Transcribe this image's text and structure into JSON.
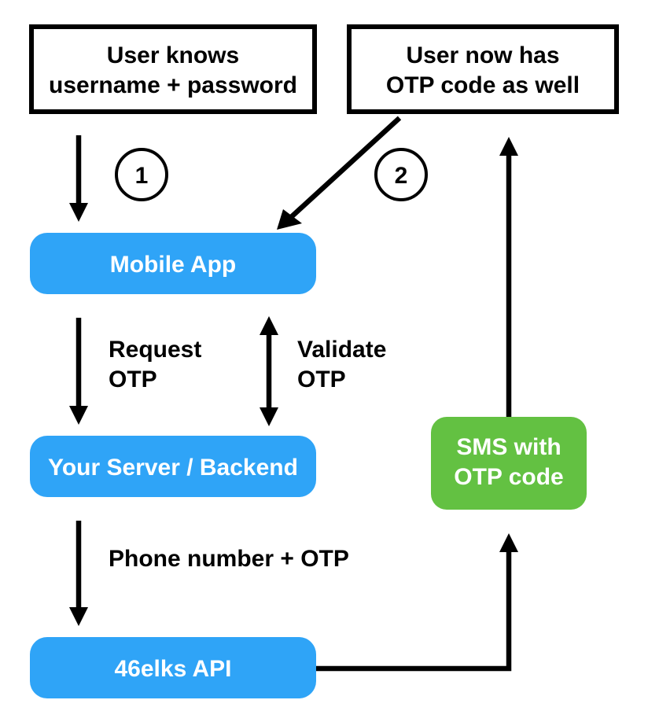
{
  "boxes": {
    "user_knows": {
      "line1": "User knows",
      "line2": "username + password"
    },
    "user_has": {
      "line1": "User now has",
      "line2": "OTP code as well"
    },
    "mobile_app": {
      "label": "Mobile App"
    },
    "backend": {
      "label": "Your Server / Backend"
    },
    "elks_api": {
      "label": "46elks API"
    },
    "sms_box": {
      "line1": "SMS with",
      "line2": "OTP code"
    }
  },
  "labels": {
    "request_otp": {
      "line1": "Request",
      "line2": "OTP"
    },
    "validate_otp": {
      "line1": "Validate",
      "line2": "OTP"
    },
    "phone_otp": {
      "line1": "Phone number + OTP"
    }
  },
  "steps": {
    "one": "1",
    "two": "2"
  }
}
